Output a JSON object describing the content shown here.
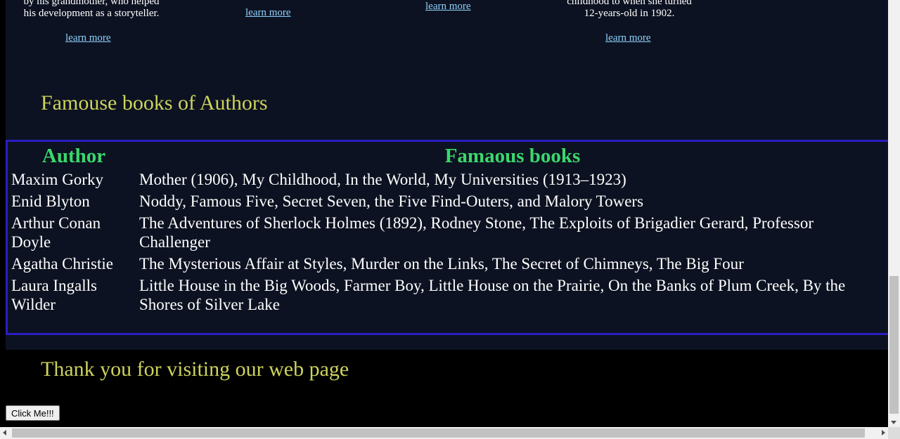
{
  "author_cards": [
    {
      "blurb_lines": [
        "by his grandmother, who helped",
        "his development as a storyteller."
      ],
      "link_label": "learn more"
    },
    {
      "blurb_lines": [],
      "link_label": "learn more"
    },
    {
      "blurb_lines": [],
      "link_label": "learn more"
    },
    {
      "blurb_lines": [
        "childhood to when she turned",
        "12-years-old in 1902."
      ],
      "link_label": "learn more"
    }
  ],
  "books_section": {
    "heading": "Famouse books of Authors",
    "table": {
      "headers": [
        "Author",
        "Famaous books"
      ],
      "rows": [
        {
          "author": "Maxim Gorky",
          "books": "Mother (1906), My Childhood, In the World, My Universities (1913–1923)"
        },
        {
          "author": "Enid Blyton",
          "books": "Noddy, Famous Five, Secret Seven, the Five Find-Outers, and Malory Towers"
        },
        {
          "author": "Arthur Conan Doyle",
          "books": "The Adventures of Sherlock Holmes (1892), Rodney Stone, The Exploits of Brigadier Gerard, Professor Challenger"
        },
        {
          "author": "Agatha Christie",
          "books": "The Mysterious Affair at Styles, Murder on the Links, The Secret of Chimneys, The Big Four"
        },
        {
          "author": "Laura Ingalls Wilder",
          "books": "Little House in the Big Woods, Farmer Boy, Little House on the Prairie, On the Banks of Plum Creek, By the Shores of Silver Lake"
        }
      ]
    }
  },
  "footer": {
    "thanks": "Thank you for visiting our web page",
    "button_label": "Click Me!!!"
  },
  "colors": {
    "panel_background": "#0c1221",
    "heading": "#cdd35a",
    "table_header": "#3ad86b",
    "table_border": "#2a1ec2",
    "link": "#8fd3fe"
  }
}
